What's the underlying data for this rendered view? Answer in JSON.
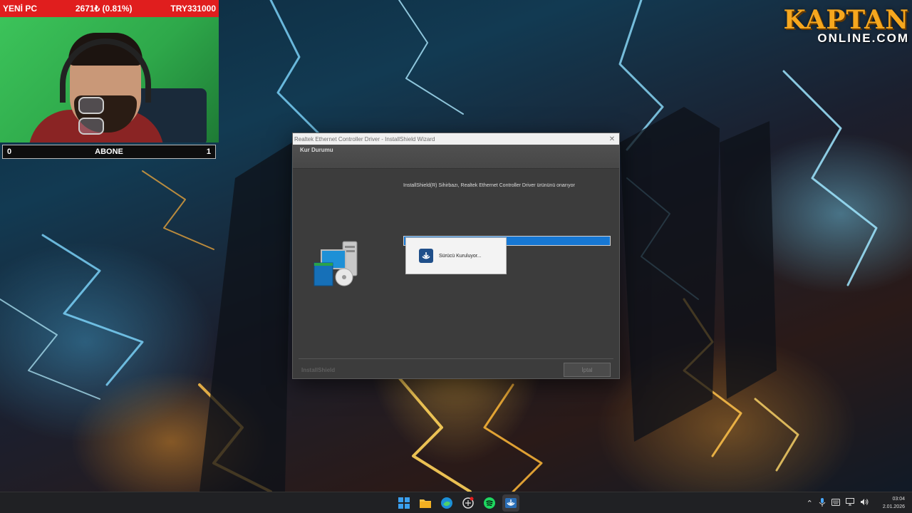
{
  "overlay": {
    "ticker": {
      "left": "YENİ PC",
      "middle": "2671₺ (0.81%)",
      "right": "TRY331000"
    },
    "abone": {
      "left": "0",
      "label": "ABONE",
      "right": "1"
    },
    "logo": {
      "top": "KAPTAN",
      "bottom": "ONLINE.COM"
    }
  },
  "window": {
    "title": "Realtek Ethernet Controller Driver - InstallShield Wizard",
    "close_glyph": "✕",
    "header": "Kur Durumu",
    "status": "InstallShield(R) Sihirbazı, Realtek Ethernet Controller Driver ürününü onarıyor",
    "progress": 1.0,
    "popup_text": "Sürücü Kuruluyor...",
    "brand": "InstallShield",
    "cancel_label": "İptal"
  },
  "taskbar": {
    "icons": [
      "windows-start-icon",
      "file-explorer-icon",
      "edge-icon",
      "chatgpt-icon",
      "spotify-icon",
      "installer-icon"
    ],
    "time": "03:04",
    "date": "2.01.2026"
  },
  "colors": {
    "progress": "#1778d4",
    "ticker": "#e01e1e",
    "logo": "#f6a71e"
  }
}
